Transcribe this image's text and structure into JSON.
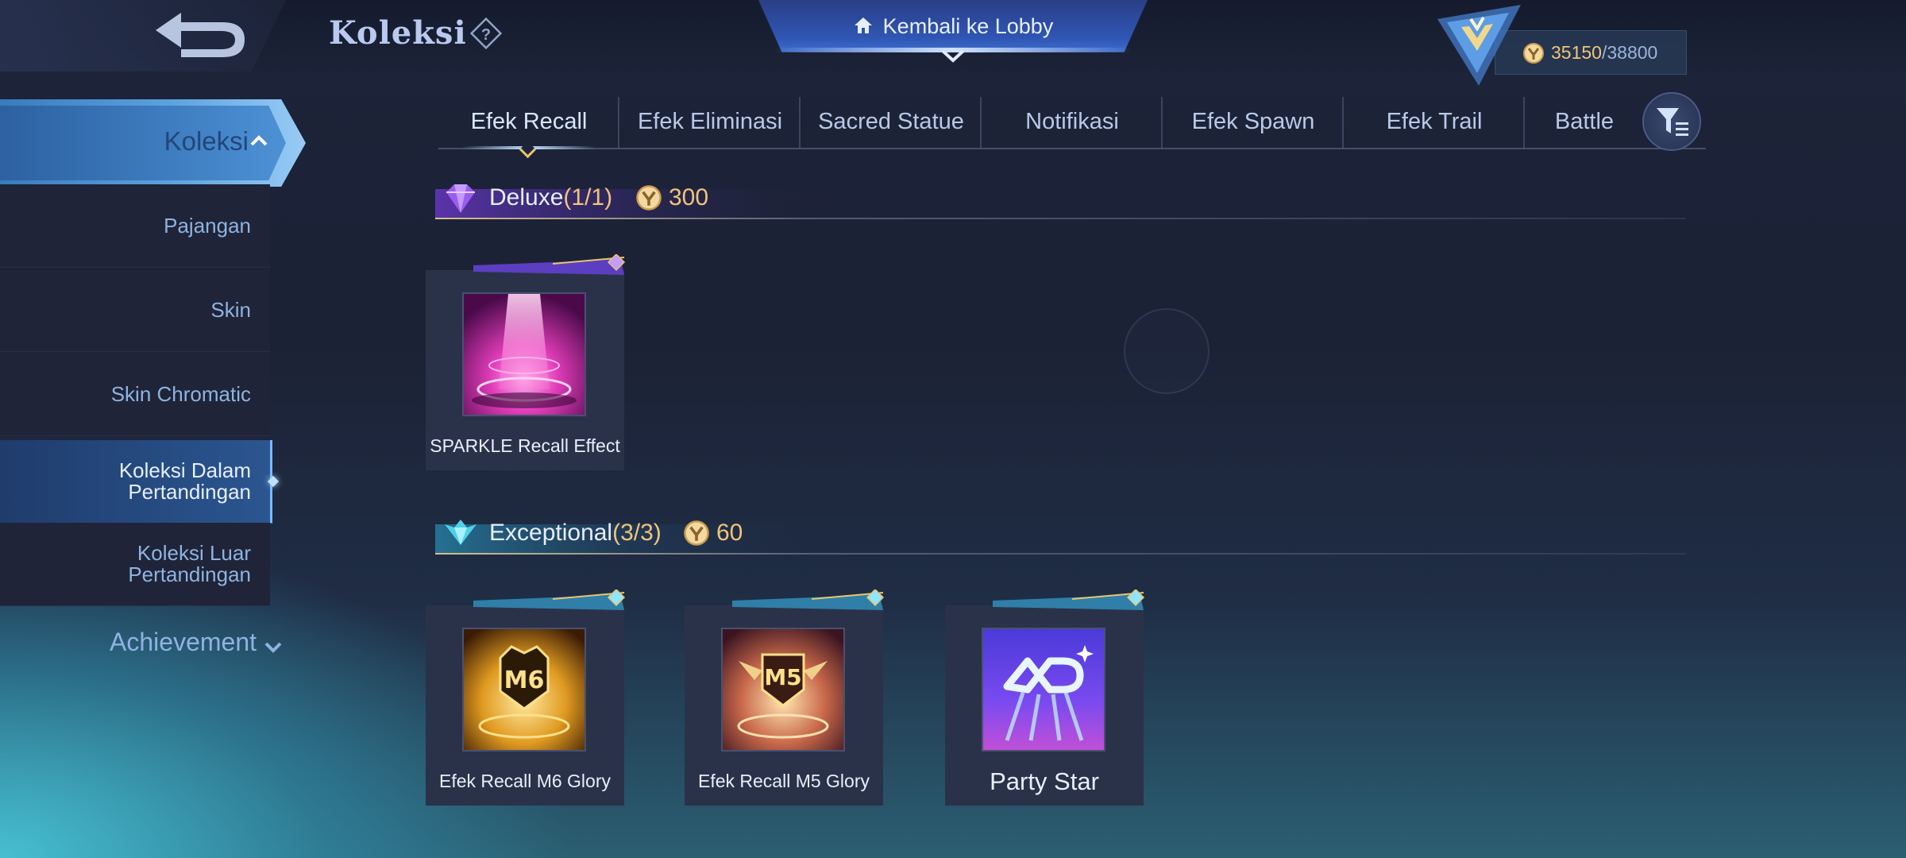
{
  "header": {
    "title": "Koleksi",
    "lobby_label": "Kembali ke Lobby",
    "currency_current": "35150",
    "currency_max": "/38800"
  },
  "sidebar": {
    "active_label": "Koleksi",
    "items": [
      {
        "label": "Pajangan",
        "selected": false
      },
      {
        "label": "Skin",
        "selected": false
      },
      {
        "label": "Skin Chromatic",
        "selected": false
      },
      {
        "label": "Koleksi Dalam\nPertandingan",
        "selected": true
      },
      {
        "label": "Koleksi Luar\nPertandingan",
        "selected": false
      }
    ],
    "achievement_label": "Achievement"
  },
  "tabs": [
    {
      "label": "Efek Recall",
      "active": true
    },
    {
      "label": "Efek Eliminasi",
      "active": false
    },
    {
      "label": "Sacred Statue",
      "active": false
    },
    {
      "label": "Notifikasi",
      "active": false
    },
    {
      "label": "Efek Spawn",
      "active": false
    },
    {
      "label": "Efek Trail",
      "active": false
    },
    {
      "label": "Battle",
      "active": false
    }
  ],
  "sections": [
    {
      "tier": "Deluxe",
      "count": "(1/1)",
      "points": "300",
      "accent": "#9b5cf0",
      "items": [
        {
          "name": "SPARKLE Recall Effect",
          "icon": "sparkle-recall-art"
        }
      ]
    },
    {
      "tier": "Exceptional",
      "count": "(3/3)",
      "points": "60",
      "accent": "#4fd0e8",
      "items": [
        {
          "name": "Efek Recall M6 Glory",
          "icon": "m6-glory-art"
        },
        {
          "name": "Efek Recall M5 Glory",
          "icon": "m5-glory-art"
        },
        {
          "name": "Party Star",
          "icon": "party-star-art"
        }
      ]
    }
  ],
  "icons": {
    "back": "back-arrow-icon",
    "help": "question-icon",
    "home": "home-icon",
    "coin": "coin-icon",
    "filter": "filter-icon",
    "rank": "rank-emblem-icon"
  },
  "colors": {
    "currency": "#f0c47a",
    "sidebar_text": "#8fb3e0",
    "active_tab_marker": "#e8c46e"
  }
}
